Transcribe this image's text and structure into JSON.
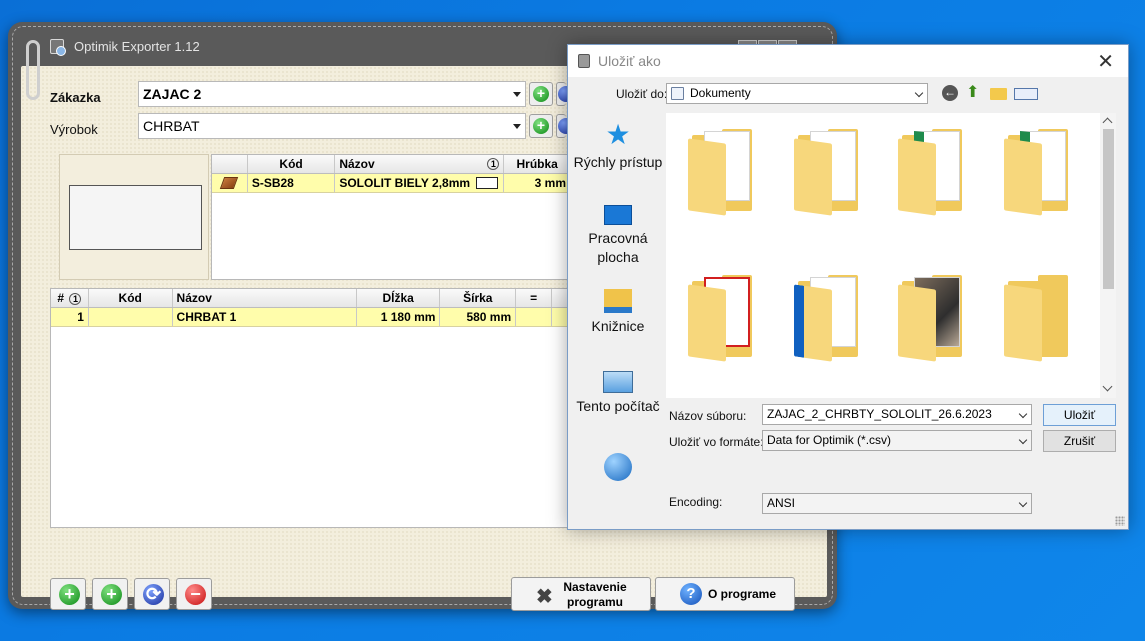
{
  "app": {
    "title": "Optimik Exporter 1.12",
    "order_label": "Zákazka",
    "order_value": "ZAJAC 2",
    "product_label": "Výrobok",
    "product_value": "CHRBAT",
    "materials_grid": {
      "columns": [
        "Kód",
        "Názov",
        "Hrúbka"
      ],
      "sort_badge": "1",
      "rows": [
        {
          "code": "S-SB28",
          "name": "SOLOLIT BIELY 2,8mm",
          "thickness": "3 mm"
        }
      ]
    },
    "parts_grid": {
      "columns": [
        "#",
        "Kód",
        "Názov",
        "Dĺžka",
        "Šírka",
        "="
      ],
      "sort_badge": "1",
      "rows": [
        {
          "num": "1",
          "code": "",
          "name": "CHRBAT 1",
          "length": "1 180 mm",
          "width": "580 mm",
          "eq": ""
        }
      ]
    },
    "settings_button": "Nastavenie programu",
    "about_button": "O programe"
  },
  "dialog": {
    "title": "Uložiť ako",
    "save_in_label": "Uložiť do:",
    "save_in_value": "Dokumenty",
    "places": [
      {
        "label": "Rýchly prístup",
        "icon": "star-icon"
      },
      {
        "label": "Pracovná plocha",
        "icon": "desktop-icon"
      },
      {
        "label": "Knižnice",
        "icon": "library-icon"
      },
      {
        "label": "Tento počítač",
        "icon": "computer-icon"
      },
      {
        "label": "",
        "icon": "network-icon"
      }
    ],
    "filename_label": "Názov súboru:",
    "filename_value": "ZAJAC_2_CHRBTY_SOLOLIT_26.6.2023",
    "format_label": "Uložiť vo formáte:",
    "format_value": "Data for Optimik (*.csv)",
    "encoding_label": "Encoding:",
    "encoding_value": "ANSI",
    "save_button": "Uložiť",
    "cancel_button": "Zrušiť"
  },
  "colors": {
    "desktop": "#0b7be3",
    "row_highlight": "#fffdab",
    "app_content_bg": "#f3eedd"
  }
}
